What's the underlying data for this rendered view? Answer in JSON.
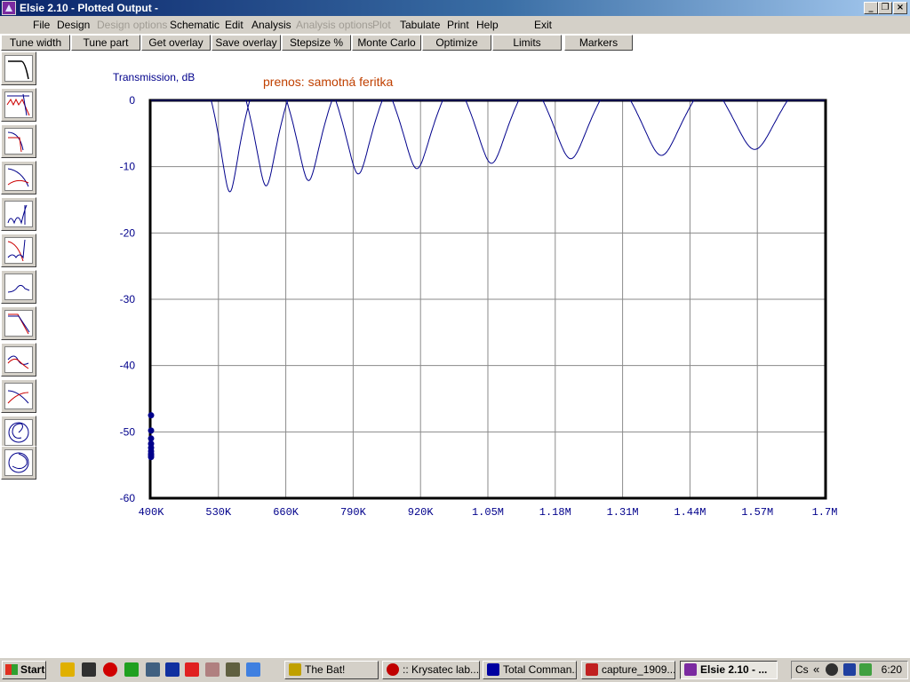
{
  "window": {
    "title": "Elsie 2.10 - Plotted Output -",
    "controls": [
      "_",
      "❐",
      "×"
    ]
  },
  "menu": [
    {
      "label": "File",
      "enabled": true
    },
    {
      "label": "Design",
      "enabled": true
    },
    {
      "label": "Design options",
      "enabled": false
    },
    {
      "label": "Schematic",
      "enabled": true
    },
    {
      "label": "Edit",
      "enabled": true
    },
    {
      "label": "Analysis",
      "enabled": true
    },
    {
      "label": "Analysis options",
      "enabled": false
    },
    {
      "label": "Plot",
      "enabled": false
    },
    {
      "label": "Tabulate",
      "enabled": true
    },
    {
      "label": "Print",
      "enabled": true
    },
    {
      "label": "Help",
      "enabled": true
    },
    {
      "label": "Exit",
      "enabled": true
    }
  ],
  "toolbar": [
    "Tune width",
    "Tune part",
    "Get overlay",
    "Save overlay",
    "Stepsize %",
    "Monte Carlo",
    "Optimize",
    "Limits",
    "Markers"
  ],
  "sidebar_icons": [
    "lowpass-response-icon",
    "bandpass-ripple-icon",
    "highpass-response-icon",
    "rolloff-response-icon",
    "elliptic-response-icon",
    "notch-response-icon",
    "bump-response-icon",
    "sloped-response-icon",
    "group-delay-icon",
    "crossover-icon",
    "smith-chart-icon",
    "polar-chart-icon"
  ],
  "plot": {
    "annotation": "prenos: samotná feritka",
    "annotation_color": "#c04000",
    "trace_color": "#00008b"
  },
  "chart_data": {
    "type": "line",
    "ylabel": "Transmission, dB",
    "xlabel": "",
    "xlim": [
      400000,
      1700000
    ],
    "ylim": [
      -60,
      0
    ],
    "x_ticks": [
      "400K",
      "530K",
      "660K",
      "790K",
      "920K",
      "1.05M",
      "1.18M",
      "1.31M",
      "1.44M",
      "1.57M",
      "1.7M"
    ],
    "y_ticks": [
      "0",
      "-10",
      "-20",
      "-30",
      "-40",
      "-50",
      "-60"
    ],
    "grid": true,
    "series": [
      {
        "peak_hz": 552000,
        "peak_db": -13.8,
        "q": 20,
        "start_db": -47.5
      },
      {
        "peak_hz": 622000,
        "peak_db": -12.9,
        "q": 20,
        "start_db": -49.8
      },
      {
        "peak_hz": 704000,
        "peak_db": -12.1,
        "q": 20,
        "start_db": -51.0
      },
      {
        "peak_hz": 800000,
        "peak_db": -11.1,
        "q": 21,
        "start_db": -51.8
      },
      {
        "peak_hz": 913000,
        "peak_db": -10.3,
        "q": 21,
        "start_db": -52.4
      },
      {
        "peak_hz": 1057000,
        "peak_db": -9.5,
        "q": 22,
        "start_db": -52.9
      },
      {
        "peak_hz": 1210000,
        "peak_db": -8.8,
        "q": 22,
        "start_db": -53.3
      },
      {
        "peak_hz": 1385000,
        "peak_db": -8.3,
        "q": 22,
        "start_db": -53.5
      },
      {
        "peak_hz": 1565000,
        "peak_db": -7.4,
        "q": 22,
        "start_db": -53.8
      }
    ]
  },
  "taskbar": {
    "start_label": "Start",
    "quicklaunch": [
      "winamp-icon",
      "batmail-icon",
      "opera-icon",
      "frog-icon",
      "shield-icon",
      "floppy-icon",
      "splat-icon",
      "info-icon",
      "calc-icon",
      "ie-icon"
    ],
    "tasks": [
      {
        "label": "The Bat!",
        "active": false,
        "color": "#c0a000"
      },
      {
        "label": ":: Krysatec lab...",
        "active": false,
        "color": "#c00000"
      },
      {
        "label": "Total Comman...",
        "active": false,
        "color": "#0000a0"
      },
      {
        "label": "capture_1909...",
        "active": false,
        "color": "#c02020"
      },
      {
        "label": "Elsie 2.10 - ...",
        "active": true,
        "color": "#7b2aa0"
      }
    ],
    "tray_text": "Cs",
    "clock": "6:20"
  }
}
